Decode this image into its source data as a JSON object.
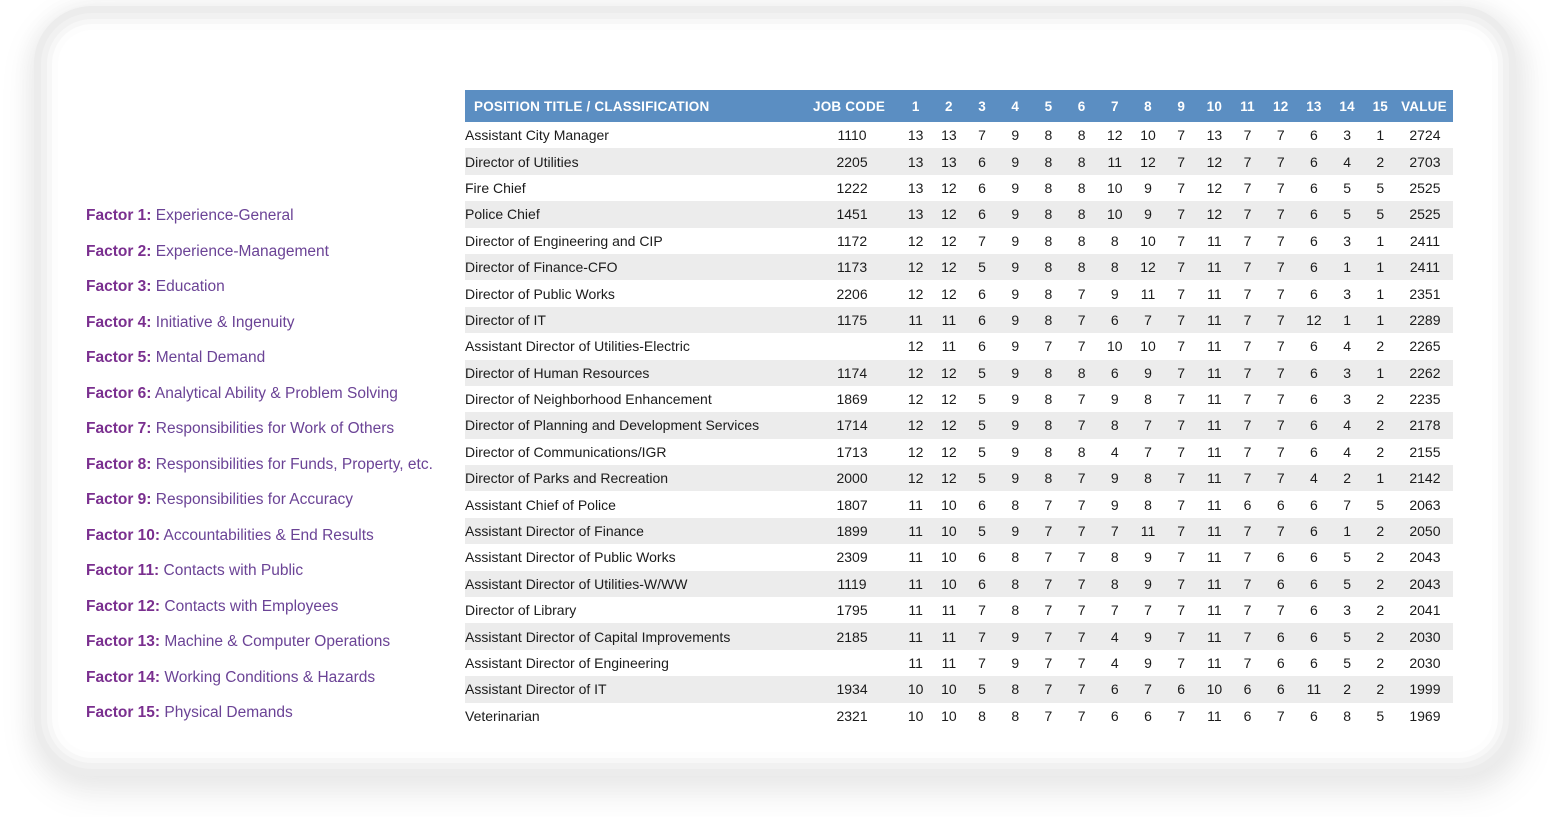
{
  "card": {
    "background": "#ffffff"
  },
  "theme": {
    "header_blue": "#5b8ec2",
    "row_stripe": "#ececec",
    "factor_purple": "#6b4396",
    "factor_key_purple": "#7a2f8f"
  },
  "factors": [
    {
      "key": "Factor 1:",
      "label": "Experience-General"
    },
    {
      "key": "Factor 2:",
      "label": "Experience-Management"
    },
    {
      "key": "Factor 3:",
      "label": "Education"
    },
    {
      "key": "Factor 4:",
      "label": "Initiative & Ingenuity"
    },
    {
      "key": "Factor 5:",
      "label": "Mental Demand"
    },
    {
      "key": "Factor 6:",
      "label": "Analytical Ability & Problem Solving"
    },
    {
      "key": "Factor 7:",
      "label": "Responsibilities for Work of Others"
    },
    {
      "key": "Factor 8:",
      "label": "Responsibilities for Funds, Property, etc."
    },
    {
      "key": "Factor 9:",
      "label": "Responsibilities for Accuracy"
    },
    {
      "key": "Factor 10:",
      "label": "Accountabilities & End Results"
    },
    {
      "key": "Factor 11:",
      "label": "Contacts with Public"
    },
    {
      "key": "Factor 12:",
      "label": "Contacts with Employees"
    },
    {
      "key": "Factor 13:",
      "label": "Machine & Computer Operations"
    },
    {
      "key": "Factor 14:",
      "label": "Working Conditions & Hazards"
    },
    {
      "key": "Factor 15:",
      "label": "Physical Demands"
    }
  ],
  "table": {
    "headers": {
      "title": "POSITION TITLE / CLASSIFICATION",
      "job_code": "JOB CODE",
      "factor_numbers": [
        "1",
        "2",
        "3",
        "4",
        "5",
        "6",
        "7",
        "8",
        "9",
        "10",
        "11",
        "12",
        "13",
        "14",
        "15"
      ],
      "value": "VALUE"
    },
    "rows": [
      {
        "title": "Assistant City Manager",
        "job_code": "1110",
        "scores": [
          13,
          13,
          7,
          9,
          8,
          8,
          12,
          10,
          7,
          13,
          7,
          7,
          6,
          3,
          1
        ],
        "value": 2724
      },
      {
        "title": "Director of Utilities",
        "job_code": "2205",
        "scores": [
          13,
          13,
          6,
          9,
          8,
          8,
          11,
          12,
          7,
          12,
          7,
          7,
          6,
          4,
          2
        ],
        "value": 2703
      },
      {
        "title": "Fire Chief",
        "job_code": "1222",
        "scores": [
          13,
          12,
          6,
          9,
          8,
          8,
          10,
          9,
          7,
          12,
          7,
          7,
          6,
          5,
          5
        ],
        "value": 2525
      },
      {
        "title": "Police Chief",
        "job_code": "1451",
        "scores": [
          13,
          12,
          6,
          9,
          8,
          8,
          10,
          9,
          7,
          12,
          7,
          7,
          6,
          5,
          5
        ],
        "value": 2525
      },
      {
        "title": "Director of Engineering and CIP",
        "job_code": "1172",
        "scores": [
          12,
          12,
          7,
          9,
          8,
          8,
          8,
          10,
          7,
          11,
          7,
          7,
          6,
          3,
          1
        ],
        "value": 2411
      },
      {
        "title": "Director of Finance-CFO",
        "job_code": "1173",
        "scores": [
          12,
          12,
          5,
          9,
          8,
          8,
          8,
          12,
          7,
          11,
          7,
          7,
          6,
          1,
          1
        ],
        "value": 2411
      },
      {
        "title": "Director of Public Works",
        "job_code": "2206",
        "scores": [
          12,
          12,
          6,
          9,
          8,
          7,
          9,
          11,
          7,
          11,
          7,
          7,
          6,
          3,
          1
        ],
        "value": 2351
      },
      {
        "title": "Director of IT",
        "job_code": "1175",
        "scores": [
          11,
          11,
          6,
          9,
          8,
          7,
          6,
          7,
          7,
          11,
          7,
          7,
          12,
          1,
          1
        ],
        "value": 2289
      },
      {
        "title": "Assistant Director of Utilities-Electric",
        "job_code": "",
        "scores": [
          12,
          11,
          6,
          9,
          7,
          7,
          10,
          10,
          7,
          11,
          7,
          7,
          6,
          4,
          2
        ],
        "value": 2265
      },
      {
        "title": "Director of Human Resources",
        "job_code": "1174",
        "scores": [
          12,
          12,
          5,
          9,
          8,
          8,
          6,
          9,
          7,
          11,
          7,
          7,
          6,
          3,
          1
        ],
        "value": 2262
      },
      {
        "title": "Director of Neighborhood Enhancement",
        "job_code": "1869",
        "scores": [
          12,
          12,
          5,
          9,
          8,
          7,
          9,
          8,
          7,
          11,
          7,
          7,
          6,
          3,
          2
        ],
        "value": 2235
      },
      {
        "title": "Director of Planning and Development Services",
        "job_code": "1714",
        "scores": [
          12,
          12,
          5,
          9,
          8,
          7,
          8,
          7,
          7,
          11,
          7,
          7,
          6,
          4,
          2
        ],
        "value": 2178
      },
      {
        "title": "Director of Communications/IGR",
        "job_code": "1713",
        "scores": [
          12,
          12,
          5,
          9,
          8,
          8,
          4,
          7,
          7,
          11,
          7,
          7,
          6,
          4,
          2
        ],
        "value": 2155
      },
      {
        "title": "Director of Parks and Recreation",
        "job_code": "2000",
        "scores": [
          12,
          12,
          5,
          9,
          8,
          7,
          9,
          8,
          7,
          11,
          7,
          7,
          4,
          2,
          1
        ],
        "value": 2142
      },
      {
        "title": "Assistant Chief of Police",
        "job_code": "1807",
        "scores": [
          11,
          10,
          6,
          8,
          7,
          7,
          9,
          8,
          7,
          11,
          6,
          6,
          6,
          7,
          5
        ],
        "value": 2063
      },
      {
        "title": "Assistant Director of Finance",
        "job_code": "1899",
        "scores": [
          11,
          10,
          5,
          9,
          7,
          7,
          7,
          11,
          7,
          11,
          7,
          7,
          6,
          1,
          2
        ],
        "value": 2050
      },
      {
        "title": "Assistant Director of Public Works",
        "job_code": "2309",
        "scores": [
          11,
          10,
          6,
          8,
          7,
          7,
          8,
          9,
          7,
          11,
          7,
          6,
          6,
          5,
          2
        ],
        "value": 2043
      },
      {
        "title": "Assistant Director of Utilities-W/WW",
        "job_code": "1119",
        "scores": [
          11,
          10,
          6,
          8,
          7,
          7,
          8,
          9,
          7,
          11,
          7,
          6,
          6,
          5,
          2
        ],
        "value": 2043
      },
      {
        "title": "Director of Library",
        "job_code": "1795",
        "scores": [
          11,
          11,
          7,
          8,
          7,
          7,
          7,
          7,
          7,
          11,
          7,
          7,
          6,
          3,
          2
        ],
        "value": 2041
      },
      {
        "title": "Assistant Director of Capital Improvements",
        "job_code": "2185",
        "scores": [
          11,
          11,
          7,
          9,
          7,
          7,
          4,
          9,
          7,
          11,
          7,
          6,
          6,
          5,
          2
        ],
        "value": 2030
      },
      {
        "title": "Assistant Director of Engineering",
        "job_code": "",
        "scores": [
          11,
          11,
          7,
          9,
          7,
          7,
          4,
          9,
          7,
          11,
          7,
          6,
          6,
          5,
          2
        ],
        "value": 2030
      },
      {
        "title": "Assistant Director of IT",
        "job_code": "1934",
        "scores": [
          10,
          10,
          5,
          8,
          7,
          7,
          6,
          7,
          6,
          10,
          6,
          6,
          11,
          2,
          2
        ],
        "value": 1999
      },
      {
        "title": "Veterinarian",
        "job_code": "2321",
        "scores": [
          10,
          10,
          8,
          8,
          7,
          7,
          6,
          6,
          7,
          11,
          6,
          7,
          6,
          8,
          5
        ],
        "value": 1969
      }
    ]
  }
}
